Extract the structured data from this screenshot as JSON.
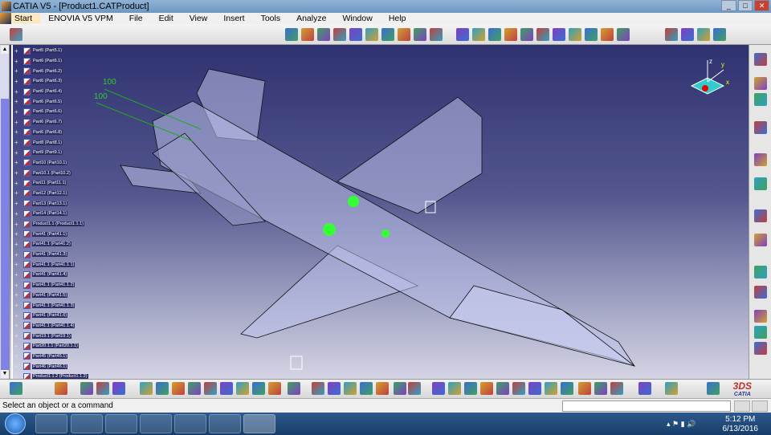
{
  "window": {
    "title": "CATIA V5 - [Product1.CATProduct]"
  },
  "menu": [
    "Start",
    "ENOVIA V5 VPM",
    "File",
    "Edit",
    "View",
    "Insert",
    "Tools",
    "Analyze",
    "Window",
    "Help"
  ],
  "tree": [
    "Part5 (Part5.1)",
    "Part6 (Part6.1)",
    "Part6 (Part6.2)",
    "Part6 (Part6.3)",
    "Part6 (Part6.4)",
    "Part6 (Part6.5)",
    "Part6 (Part6.6)",
    "Part6 (Part6.7)",
    "Part6 (Part6.8)",
    "Part8 (Part8.1)",
    "Part9 (Part9.1)",
    "Part10 (Part10.1)",
    "Part10.1 (Part10.2)",
    "Part11 (Part11.1)",
    "Part12 (Part12.1)",
    "Part13 (Part13.1)",
    "Part14 (Part14.1)",
    "Product1.1 (Product1.1.1)",
    "Part41 (Part41.1)",
    "Part41.1 (Part41.2)",
    "Part41 (Part41.3)",
    "Part41.1 (Part41.1.1)",
    "Part41 (Part41.4)",
    "Part41.1 (Part41.1.2)",
    "Part41 (Part41.5)",
    "Part41.1 (Part41.1.3)",
    "Part41 (Part41.6)",
    "Part41.1 (Part41.1.4)",
    "Part19.1 (Part19.1)",
    "Part20.1.1 (Part20.1.1)",
    "Part45 (Part45.1)",
    "Part46 (Part46.1)",
    "Product1.1.2 (Product1.1.2)"
  ],
  "viewport": {
    "dim1": "100",
    "dim2": "100",
    "compass_x": "x",
    "compass_y": "y",
    "compass_z": "z"
  },
  "status": {
    "message": "Select an object or a command",
    "command_value": ""
  },
  "taskbar": {
    "time": "5:12 PM",
    "date": "6/13/2016"
  },
  "brand": {
    "logo_text": "CATIA"
  }
}
